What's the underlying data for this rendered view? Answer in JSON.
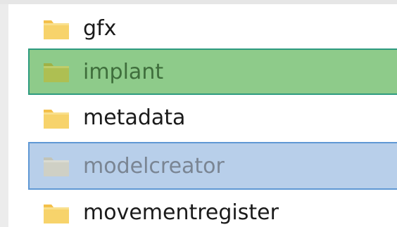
{
  "file_list": {
    "items": [
      {
        "name": "gfx",
        "icon": "folder-icon",
        "state": "normal"
      },
      {
        "name": "implant",
        "icon": "folder-icon",
        "state": "selected-green"
      },
      {
        "name": "metadata",
        "icon": "folder-icon",
        "state": "normal"
      },
      {
        "name": "modelcreator",
        "icon": "folder-icon",
        "state": "selected-blue"
      },
      {
        "name": "movementregister",
        "icon": "folder-icon",
        "state": "normal"
      }
    ]
  },
  "colors": {
    "folder_yellow": "#f7d36b",
    "folder_green_tint": "#aebf52",
    "folder_gray_tint": "#cfd0c5",
    "green_highlight": "#8ecb8a",
    "green_border": "#2e9b7f",
    "blue_highlight": "#b8cfea",
    "blue_border": "#5f98d4"
  }
}
